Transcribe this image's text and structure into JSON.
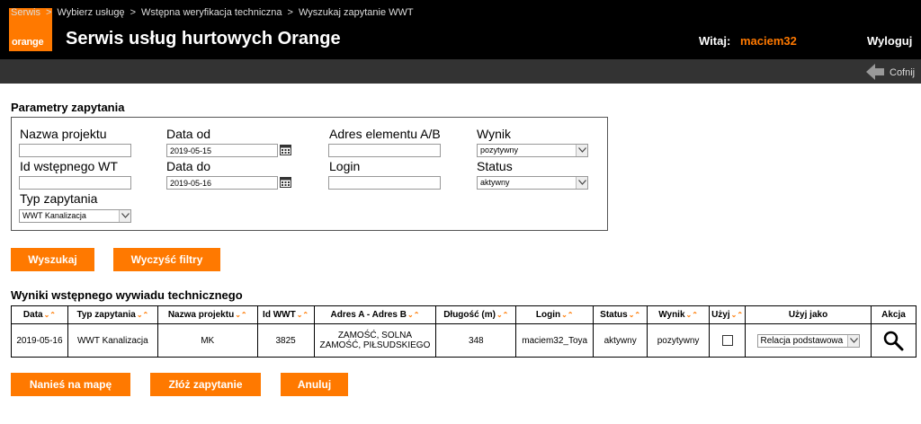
{
  "header": {
    "logo_text": "orange",
    "title": "Serwis usług hurtowych Orange",
    "welcome_label": "Witaj:",
    "username": "maciem32",
    "logout_label": "Wyloguj",
    "brand_color": "#ff7900"
  },
  "breadcrumb": {
    "items": [
      "Serwis",
      "Wybierz usługę",
      "Wstępna weryfikacja techniczna",
      "Wyszukaj zapytanie WWT"
    ],
    "separator": ">",
    "back_label": "Cofnij"
  },
  "filters": {
    "section_title": "Parametry zapytania",
    "project_name": {
      "label": "Nazwa projektu",
      "value": ""
    },
    "wt_id": {
      "label": "Id wstępnego WT",
      "value": ""
    },
    "request_type": {
      "label": "Typ zapytania",
      "value": "WWT Kanalizacja"
    },
    "date_from": {
      "label": "Data od",
      "value": "2019-05-15"
    },
    "date_to": {
      "label": "Data do",
      "value": "2019-05-16"
    },
    "element_address": {
      "label": "Adres elementu A/B",
      "value": ""
    },
    "login": {
      "label": "Login",
      "value": ""
    },
    "result": {
      "label": "Wynik",
      "value": "pozytywny"
    },
    "status": {
      "label": "Status",
      "value": "aktywny"
    }
  },
  "actions": {
    "search_label": "Wyszukaj",
    "clear_label": "Wyczyść filtry"
  },
  "results": {
    "section_title": "Wyniki wstępnego wywiadu technicznego",
    "sort_glyph": "⌄⌃",
    "columns": [
      "Data",
      "Typ zapytania",
      "Nazwa projektu",
      "Id WWT",
      "Adres A - Adres B",
      "Długość (m)",
      "Login",
      "Status",
      "Wynik",
      "Użyj",
      "Użyj jako",
      "Akcja"
    ],
    "rows": [
      {
        "date": "2019-05-16",
        "type": "WWT Kanalizacja",
        "project": "MK",
        "id": "3825",
        "address_a": "ZAMOŚĆ, SOLNA",
        "address_b": "ZAMOŚĆ, PIŁSUDSKIEGO",
        "length": "348",
        "login": "maciem32_Toya",
        "status": "aktywny",
        "result": "pozytywny",
        "use_as": "Relacja podstawowa"
      }
    ]
  },
  "bottom_actions": {
    "map_label": "Nanieś na mapę",
    "submit_label": "Złóż zapytanie",
    "cancel_label": "Anuluj"
  },
  "icons": {
    "back": "arrow-left-icon",
    "calendar": "calendar-icon",
    "search": "magnifier-icon",
    "dropdown": "chevron-down-icon"
  }
}
